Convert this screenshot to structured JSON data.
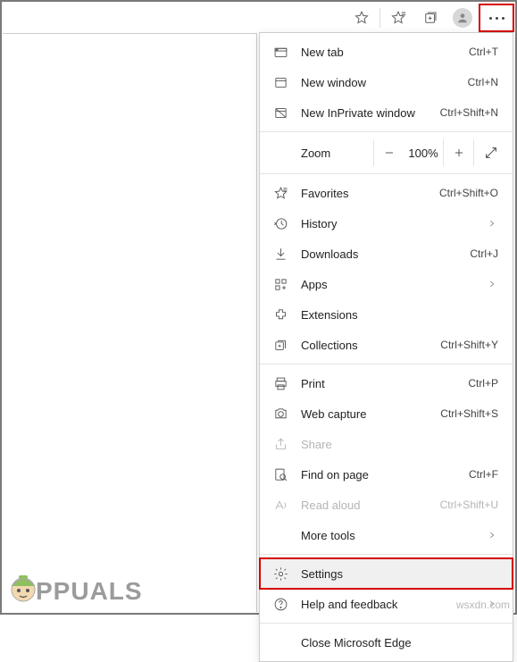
{
  "toolbar": {
    "favorite_icon": "star-icon",
    "favorites_icon": "star-plus-icon",
    "collections_icon": "collections-icon",
    "profile_icon": "profile-icon",
    "more_icon": "more-icon"
  },
  "menu": {
    "new_tab": {
      "label": "New tab",
      "shortcut": "Ctrl+T"
    },
    "new_window": {
      "label": "New window",
      "shortcut": "Ctrl+N"
    },
    "new_inprivate": {
      "label": "New InPrivate window",
      "shortcut": "Ctrl+Shift+N"
    },
    "zoom": {
      "label": "Zoom",
      "value": "100%"
    },
    "favorites": {
      "label": "Favorites",
      "shortcut": "Ctrl+Shift+O"
    },
    "history": {
      "label": "History"
    },
    "downloads": {
      "label": "Downloads",
      "shortcut": "Ctrl+J"
    },
    "apps": {
      "label": "Apps"
    },
    "extensions": {
      "label": "Extensions"
    },
    "collections": {
      "label": "Collections",
      "shortcut": "Ctrl+Shift+Y"
    },
    "print": {
      "label": "Print",
      "shortcut": "Ctrl+P"
    },
    "web_capture": {
      "label": "Web capture",
      "shortcut": "Ctrl+Shift+S"
    },
    "share": {
      "label": "Share"
    },
    "find": {
      "label": "Find on page",
      "shortcut": "Ctrl+F"
    },
    "read_aloud": {
      "label": "Read aloud",
      "shortcut": "Ctrl+Shift+U"
    },
    "more_tools": {
      "label": "More tools"
    },
    "settings": {
      "label": "Settings"
    },
    "help": {
      "label": "Help and feedback"
    },
    "close": {
      "label": "Close Microsoft Edge"
    }
  },
  "watermark": {
    "brand": "PPUALS",
    "source": "wsxdn.com"
  }
}
